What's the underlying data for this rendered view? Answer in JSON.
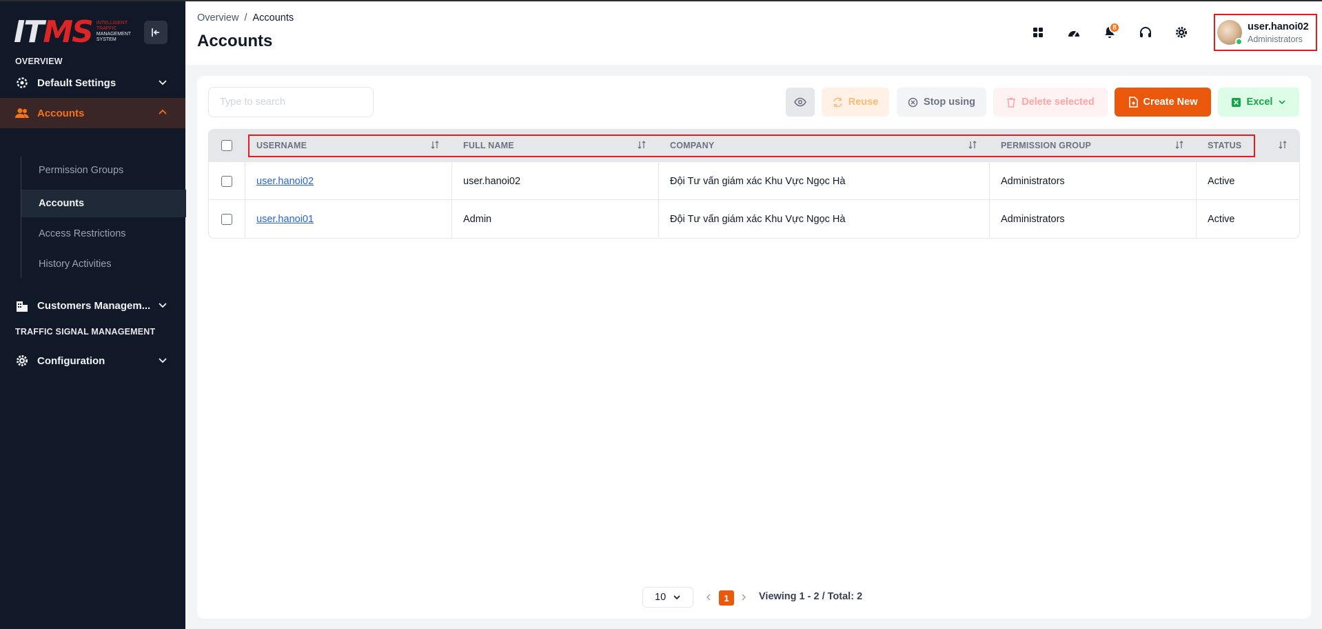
{
  "app": {
    "logo_text_a": "IT",
    "logo_text_b": "MS",
    "logo_sub_line1": "INTELLIGENT",
    "logo_sub_line2": "TRAFFIC",
    "logo_sub_line3": "MANAGEMENT",
    "logo_sub_line4": "SYSTEM"
  },
  "sidebar": {
    "section_overview": "OVERVIEW",
    "default_settings": "Default Settings",
    "accounts": "Accounts",
    "sub_items": [
      "Permission Groups",
      "Accounts",
      "Access Restrictions",
      "History Activities"
    ],
    "customers": "Customers Managem...",
    "section_traffic": "TRAFFIC SIGNAL MANAGEMENT",
    "configuration": "Configuration",
    "active_color": "#f97316"
  },
  "header": {
    "breadcrumb_root": "Overview",
    "breadcrumb_sep": "/",
    "breadcrumb_current": "Accounts",
    "title": "Accounts",
    "notification_count": "8",
    "user_name": "user.hanoi02",
    "user_role": "Administrators"
  },
  "toolbar": {
    "search_placeholder": "Type to search",
    "reuse": "Reuse",
    "stop_using": "Stop using",
    "delete_selected": "Delete selected",
    "create_new": "Create New",
    "excel": "Excel",
    "brand_color": "#ea580c"
  },
  "table": {
    "headers": [
      "USERNAME",
      "FULL NAME",
      "COMPANY",
      "PERMISSION GROUP",
      "STATUS"
    ],
    "rows": [
      {
        "username": "user.hanoi02",
        "full_name": "user.hanoi02",
        "company": "Đội Tư vấn giám xác Khu Vực Ngọc Hà",
        "group": "Administrators",
        "status": "Active"
      },
      {
        "username": "user.hanoi01",
        "full_name": "Admin",
        "company": "Đội Tư vấn giám xác Khu Vực Ngọc Hà",
        "group": "Administrators",
        "status": "Active"
      }
    ]
  },
  "pagination": {
    "page_size": "10",
    "current_page": "1",
    "viewing": "Viewing 1 - 2 / Total: 2"
  }
}
